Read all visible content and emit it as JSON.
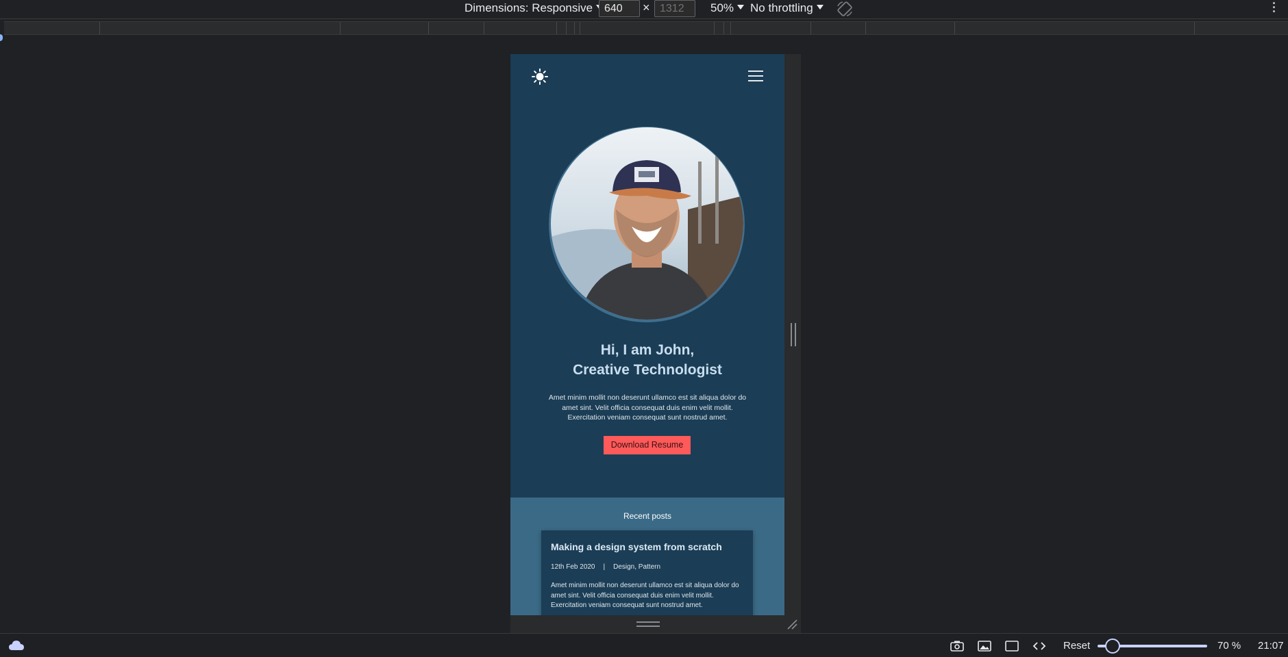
{
  "toolbar": {
    "dimensions_label": "Dimensions: Responsive",
    "width_value": "640",
    "times": "×",
    "height_placeholder": "1312",
    "zoom_label": "50%",
    "throttle_label": "No throttling"
  },
  "page": {
    "hero_title_line1": "Hi, I am John,",
    "hero_title_line2": "Creative Technologist",
    "hero_text": "Amet minim mollit non deserunt ullamco est sit aliqua dolor do amet sint. Velit officia consequat duis enim velit mollit. Exercitation veniam consequat sunt nostrud amet.",
    "cta_label": "Download Resume",
    "recent_posts_heading": "Recent posts",
    "post": {
      "title": "Making a design system from scratch",
      "date": "12th Feb 2020",
      "separator": "|",
      "tags": "Design, Pattern",
      "excerpt": "Amet minim mollit non deserunt ullamco est sit aliqua dolor do amet sint. Velit officia consequat duis enim velit mollit. Exercitation veniam consequat sunt nostrud amet."
    }
  },
  "taskbar": {
    "reset_label": "Reset",
    "zoom_percent": "70 %",
    "clock": "21:07",
    "zoom_slider_fraction": 0.1
  },
  "colors": {
    "devtools_bg": "#202124",
    "device_bg": "#1b3d55",
    "posts_bg": "#3b6a86",
    "cta_bg": "#ff5a5a",
    "slider_accent": "#c8d3ff"
  },
  "icons": [
    "sun-icon",
    "hamburger-menu-icon",
    "rotate-icon",
    "more-options-icon",
    "cloud-icon",
    "camera-icon",
    "image-icon",
    "window-icon",
    "code-icon"
  ]
}
